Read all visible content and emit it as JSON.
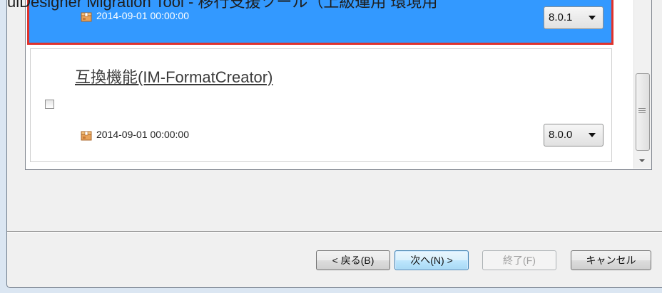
{
  "window": {
    "title_partial": "uiDesigner Migration Tool - 移行支援ツール（上級運用 環境用"
  },
  "packages": [
    {
      "name": "",
      "date": "2014-09-01 00:00:00",
      "version": "8.0.1",
      "selected": true,
      "icon": "package-icon"
    },
    {
      "name": "互換機能(IM-FormatCreator)",
      "date": "2014-09-01 00:00:00",
      "version": "8.0.0",
      "checked": false,
      "icon": "package-icon"
    }
  ],
  "buttons": {
    "back": "< 戻る(B)",
    "next": "次へ(N) >",
    "finish": "終了(F)",
    "cancel": "キャンセル"
  },
  "colors": {
    "selection": "#3399ff",
    "selection_border": "#e0322c",
    "focus_border": "#3c7fb1"
  }
}
